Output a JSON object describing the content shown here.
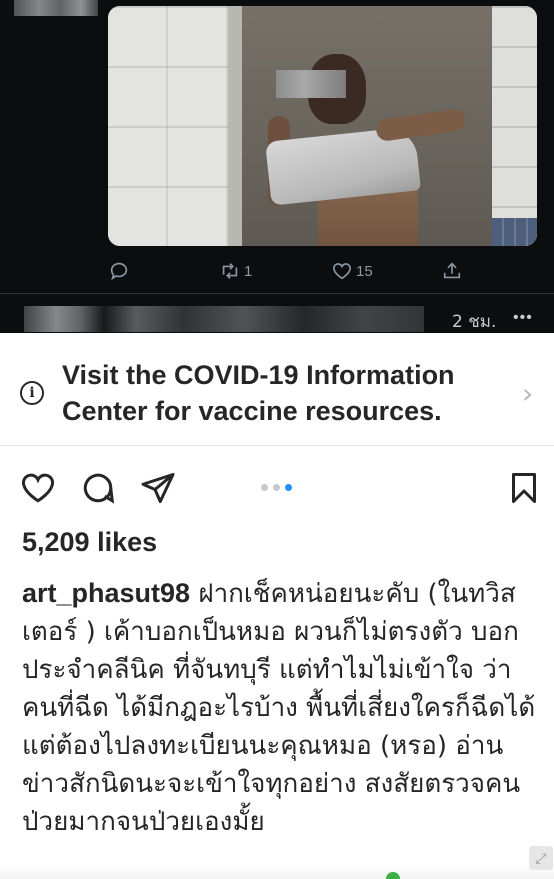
{
  "twitter": {
    "replies_icon": "reply-icon",
    "retweet_count": "1",
    "like_count": "15",
    "share_icon": "share-icon",
    "next_post_time": "2 ชม.",
    "more_label": "•••"
  },
  "instagram": {
    "banner": {
      "line1": "Visit the COVID-19 Information",
      "line2": "Center for vaccine resources.",
      "chevron": "›"
    },
    "carousel": {
      "total": 3,
      "active": 3
    },
    "likes": "5,209 likes",
    "caption_user": "art_phasut98",
    "caption_text": "ฝากเช็คหน่อยนะคับ (ในทวิสเตอร์ ) เค้าบอกเป็นหมอ ผวนก็ไม่ตรงตัว บอกประจำคลีนิค ที่จันทบุรี แต่ทำไมไม่เข้าใจ ว่าคนที่ฉีด ได้มีกฎอะไรบ้าง พื้นที่เสี่ยงใครก็ฉีดได้ แต่ต้องไปลงทะเบียนนะคุณหมอ (หรอ) อ่านข่าวสักนิดนะจะเข้าใจทุกอย่าง สงสัยตรวจคนป่วยมากจนป่วยเองมั้ย"
  }
}
